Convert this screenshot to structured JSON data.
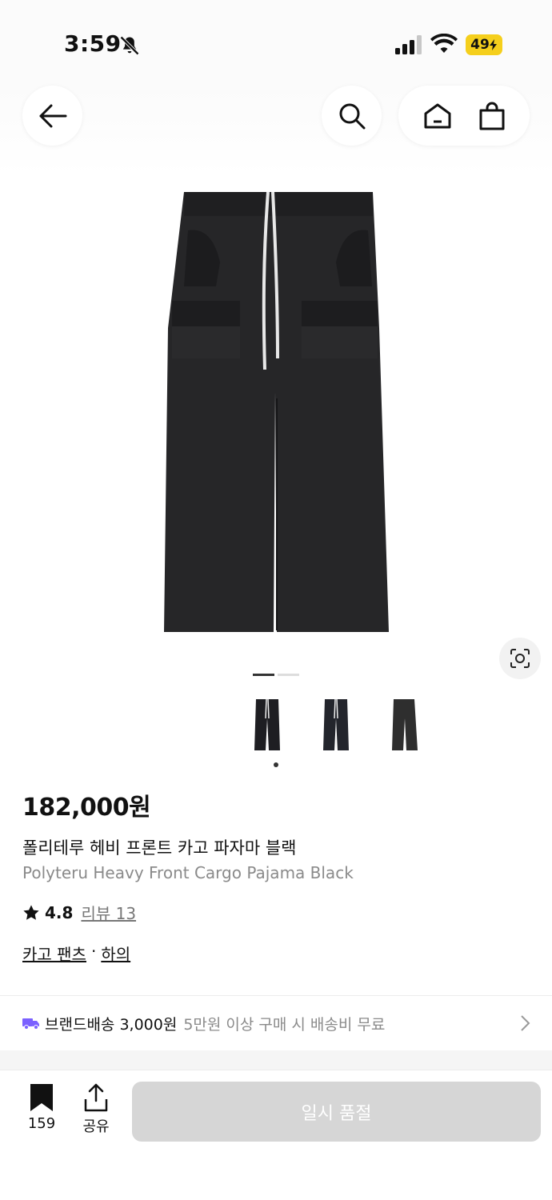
{
  "status_bar": {
    "time": "3:59",
    "battery": "49"
  },
  "header": {
    "icons": [
      "back-arrow-icon",
      "search-icon",
      "home-icon",
      "shopping-bag-icon"
    ]
  },
  "product": {
    "price": "182,000원",
    "title_kr": "폴리테루 헤비 프론트 카고 파자마 블랙",
    "title_en": "Polyteru Heavy Front Cargo Pajama Black",
    "rating": "4.8",
    "review_label": "리뷰 13",
    "category": "카고 팬츠",
    "category_sep": "·",
    "parent_category": "하의"
  },
  "gallery": {
    "active_index": 0,
    "total_pages": 2,
    "thumbnail_count": 3
  },
  "shipping": {
    "label": "브랜드배송 3,000원",
    "note": "5만원 이상 구매 시 배송비 무료"
  },
  "bottom_bar": {
    "bookmark_count": "159",
    "share_label": "공유",
    "soldout_label": "일시 품절"
  },
  "colors": {
    "accent_purple": "#7b61ff",
    "battery_yellow": "#f5cf1c",
    "disabled_button": "#d6d6d6"
  }
}
